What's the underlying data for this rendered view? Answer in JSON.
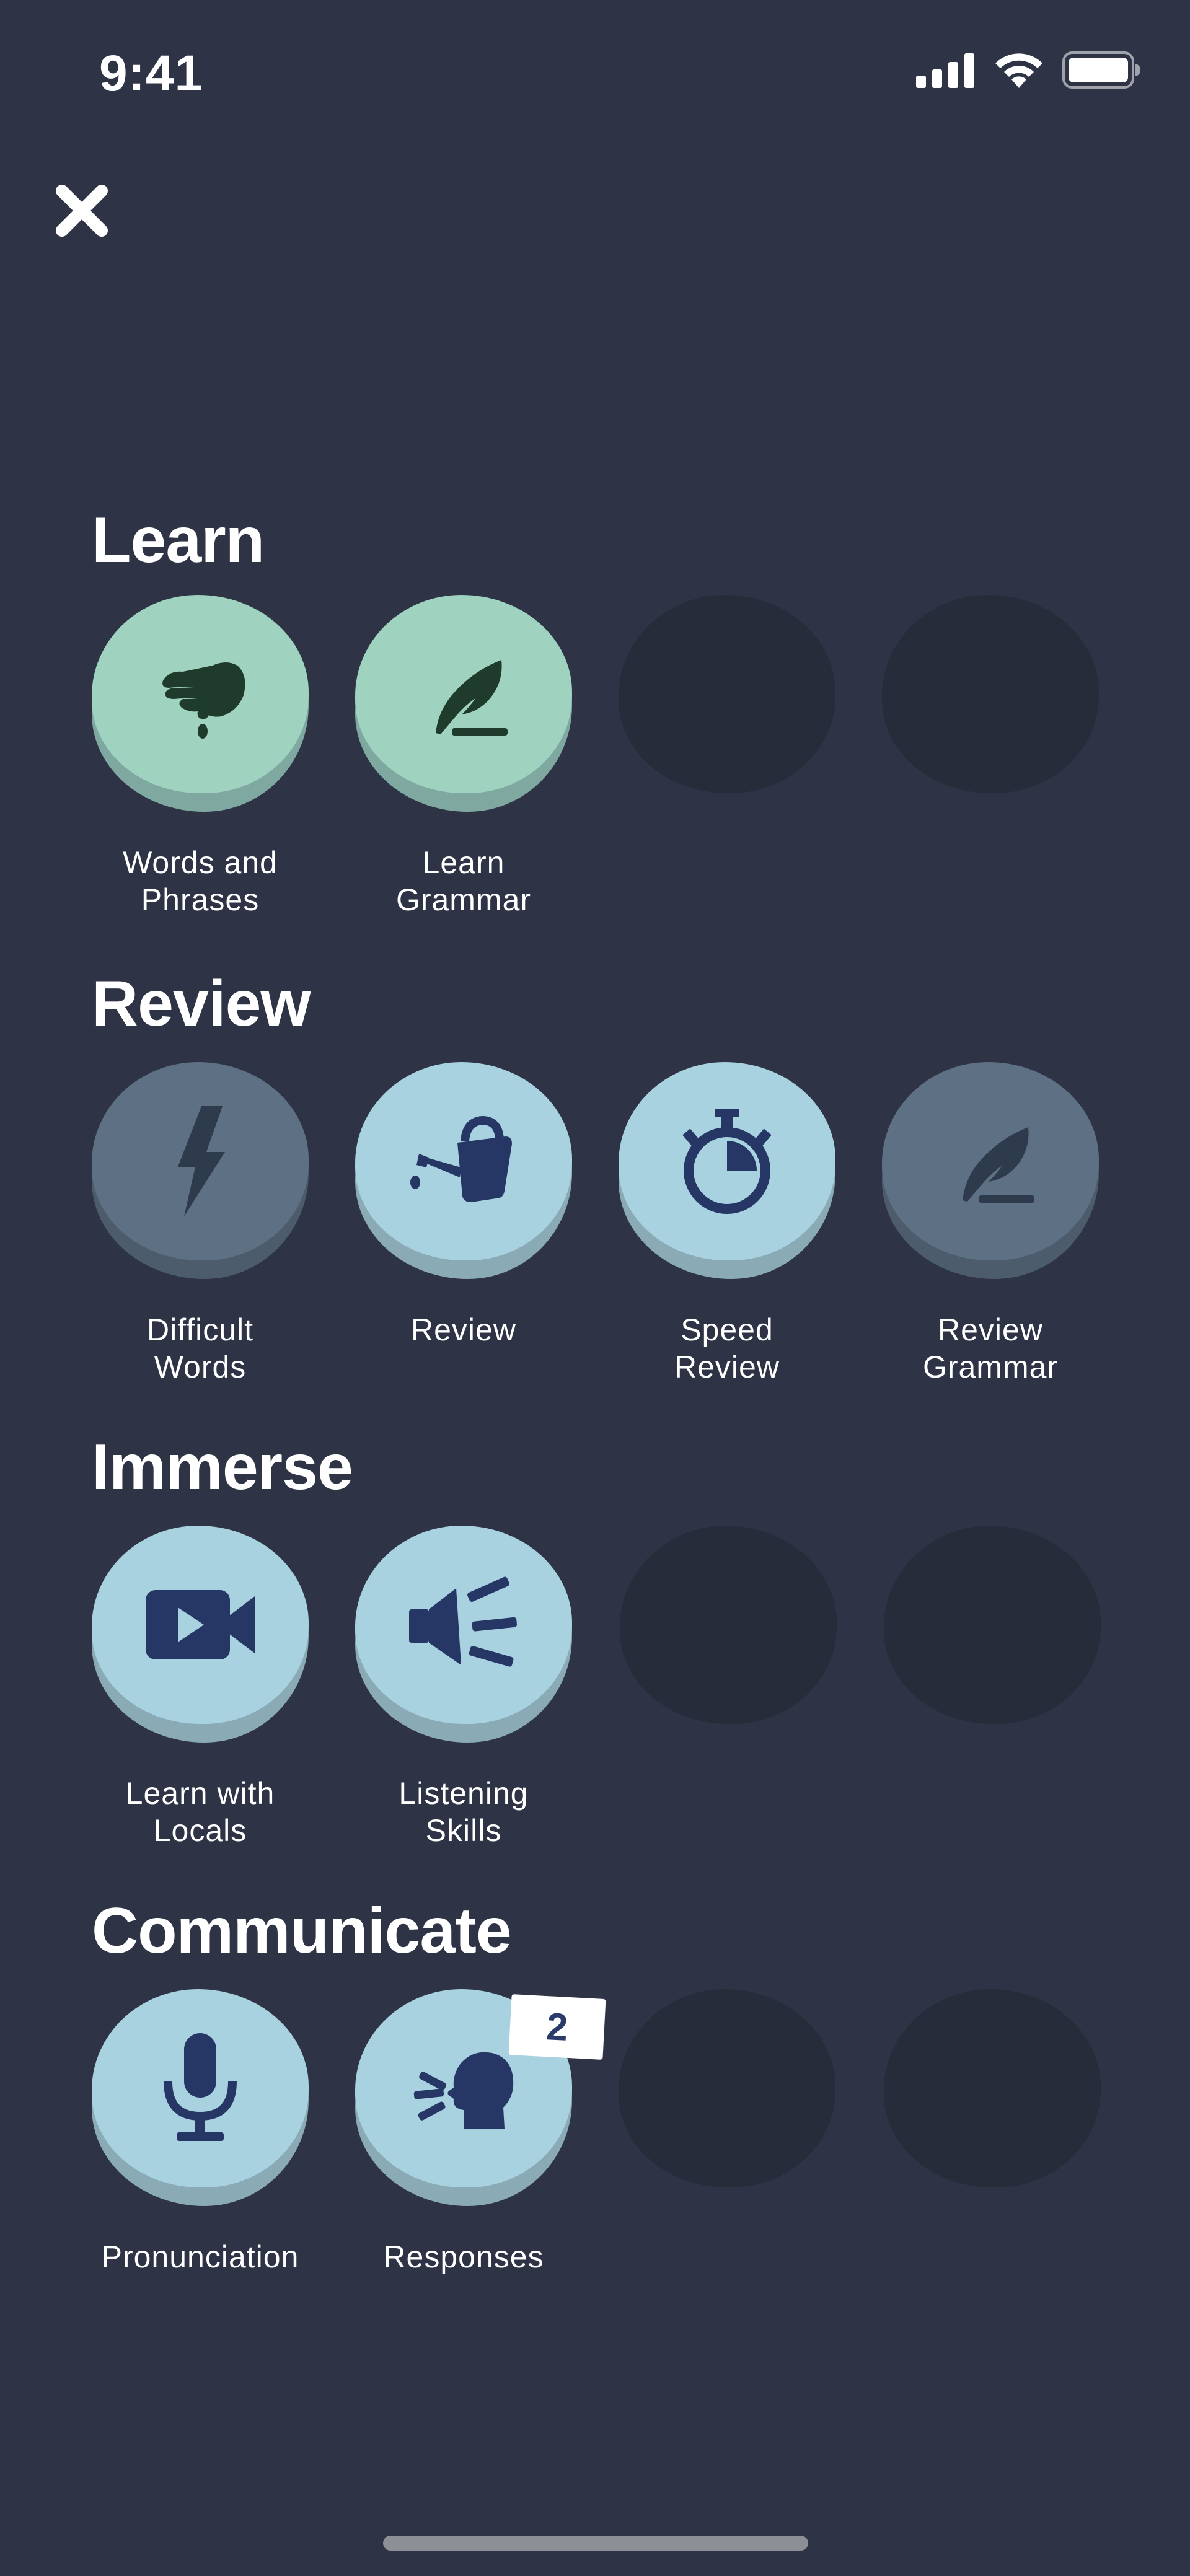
{
  "status_bar": {
    "time": "9:41",
    "signal_icon": "cellular-signal-icon",
    "wifi_icon": "wifi-icon",
    "battery_icon": "battery-icon"
  },
  "close_icon": "close-icon",
  "colors": {
    "background": "#2e3445",
    "learn_tile": "#9fd3c0",
    "active_tile": "#a9d2e1",
    "locked_tile": "#5e7184",
    "empty_slot": "#262c3a",
    "icon_dark_green": "#1f3b2c",
    "icon_navy": "#263766"
  },
  "sections": [
    {
      "title": "Learn",
      "tiles": [
        {
          "label": "Words and\nPhrases",
          "icon": "pinch-hand-icon",
          "state": "green"
        },
        {
          "label": "Learn\nGrammar",
          "icon": "quill-icon",
          "state": "green"
        }
      ]
    },
    {
      "title": "Review",
      "tiles": [
        {
          "label": "Difficult\nWords",
          "icon": "lightning-bolt-icon",
          "state": "grey"
        },
        {
          "label": "Review",
          "icon": "watering-can-icon",
          "state": "blue"
        },
        {
          "label": "Speed\nReview",
          "icon": "stopwatch-icon",
          "state": "blue"
        },
        {
          "label": "Review\nGrammar",
          "icon": "quill-icon",
          "state": "grey"
        }
      ]
    },
    {
      "title": "Immerse",
      "tiles": [
        {
          "label": "Learn with\nLocals",
          "icon": "video-camera-icon",
          "state": "blue"
        },
        {
          "label": "Listening\nSkills",
          "icon": "megaphone-icon",
          "state": "blue"
        }
      ]
    },
    {
      "title": "Communicate",
      "tiles": [
        {
          "label": "Pronunciation",
          "icon": "microphone-icon",
          "state": "blue"
        },
        {
          "label": "Responses",
          "icon": "speaking-head-icon",
          "state": "blue",
          "badge": "2"
        }
      ]
    }
  ]
}
